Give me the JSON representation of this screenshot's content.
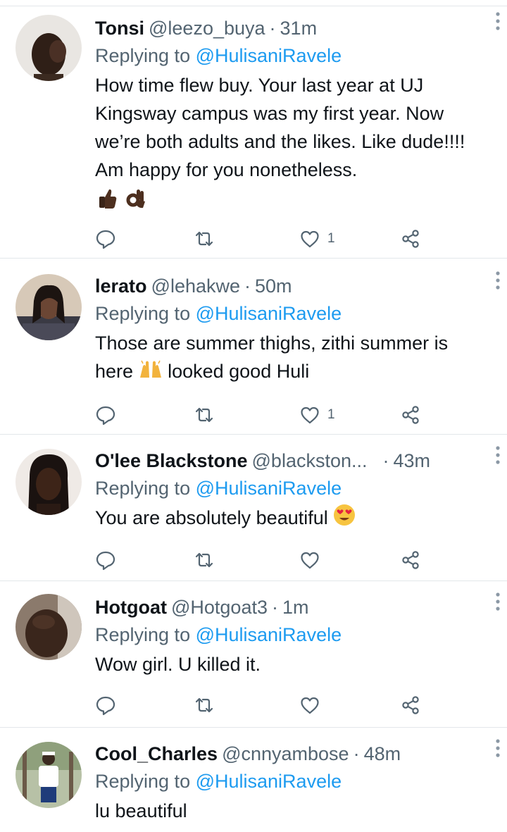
{
  "colors": {
    "text": "#0f1419",
    "muted": "#536471",
    "link": "#1d9bf0",
    "divider": "#e3e7ea"
  },
  "replying_prefix": "Replying to",
  "tweets": [
    {
      "name": "Tonsi",
      "handle": "@leezo_buya",
      "time": "31m",
      "replying_to": "@HulisaniRavele",
      "text": "How time flew buy. Your last year at UJ Kingsway campus was my first year. Now we’re both adults and the likes. Like dude!!!! Am happy for you nonetheless.",
      "emojis": [
        "thumbs-up-emoji",
        "ok-hand-emoji"
      ],
      "likes": "1"
    },
    {
      "name": "lerato",
      "handle": "@lehakwe",
      "time": "50m",
      "replying_to": "@HulisaniRavele",
      "text_before_emoji": "Those are summer thighs, zithi summer is here",
      "text_after_emoji": "looked good Huli",
      "emoji": "raising-hands-emoji",
      "likes": "1"
    },
    {
      "name": "O'lee Blackstone",
      "handle": "@blackston...",
      "time": "43m",
      "replying_to": "@HulisaniRavele",
      "text": "You are absolutely beautiful",
      "emoji": "heart-eyes-emoji",
      "likes": ""
    },
    {
      "name": "Hotgoat",
      "handle": "@Hotgoat3",
      "time": "1m",
      "replying_to": "@HulisaniRavele",
      "text": "Wow girl. U killed it.",
      "likes": ""
    },
    {
      "name": "Cool_Charles",
      "handle": "@cnnyambose",
      "time": "48m",
      "replying_to": "@HulisaniRavele",
      "text": "lu beautiful",
      "likes": ""
    }
  ],
  "icons": {
    "reply": "reply-icon",
    "retweet": "retweet-icon",
    "like": "heart-icon",
    "share": "share-icon",
    "more": "more-icon"
  }
}
